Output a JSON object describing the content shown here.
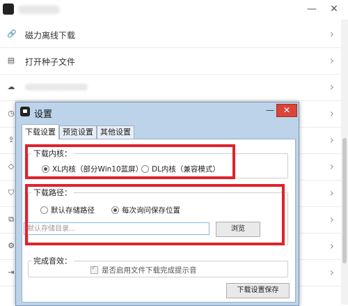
{
  "background_app": {
    "window_controls": {
      "minimize": "—",
      "close": "✕"
    },
    "menu_items": [
      {
        "label": "磁力离线下载",
        "icon": "link-icon",
        "glyph": "🔗"
      },
      {
        "label": "打开种子文件",
        "icon": "file-icon",
        "glyph": "▤"
      },
      {
        "label": "",
        "icon": "cloud-icon",
        "glyph": "☁"
      },
      {
        "label": "",
        "icon": "clock-icon",
        "glyph": "◷"
      },
      {
        "label": "",
        "icon": "upload-icon",
        "glyph": "⇪"
      },
      {
        "label": "",
        "icon": "diamond-icon",
        "glyph": "◇"
      },
      {
        "label": "",
        "icon": "shield-icon",
        "glyph": "⛉"
      },
      {
        "label": "",
        "icon": "network-icon",
        "glyph": "⧉"
      },
      {
        "label": "",
        "icon": "gear-icon",
        "glyph": "⚙"
      },
      {
        "label": "",
        "icon": "exit-icon",
        "glyph": "⇥"
      }
    ],
    "chevron": "›"
  },
  "dialog": {
    "title": "设置",
    "minimize": "—",
    "close": "✕",
    "tabs": [
      {
        "label": "下载设置",
        "active": true
      },
      {
        "label": "预览设置",
        "active": false
      },
      {
        "label": "其他设置",
        "active": false
      }
    ],
    "download_core": {
      "legend": "下载内核：",
      "options": [
        {
          "label": "XL内核（部分Win10蓝屏）",
          "selected": true
        },
        {
          "label": "DL内核（兼容模式）",
          "selected": false
        }
      ]
    },
    "download_path": {
      "legend": "下载路径：",
      "options": [
        {
          "label": "默认存储路径",
          "selected": false
        },
        {
          "label": "每次询问保存位置",
          "selected": true
        }
      ],
      "input_placeholder": "默认存储目录...",
      "input_value": "",
      "browse_label": "浏览"
    },
    "completion_sound": {
      "legend": "完成音效：",
      "checkbox_label": "是否启用文件下载完成提示音",
      "checked": true
    },
    "save_label": "下载设置保存"
  },
  "colors": {
    "highlight": "#e0222c",
    "dialog_frame": "#bcd3ea",
    "close_button": "#d9453a"
  }
}
